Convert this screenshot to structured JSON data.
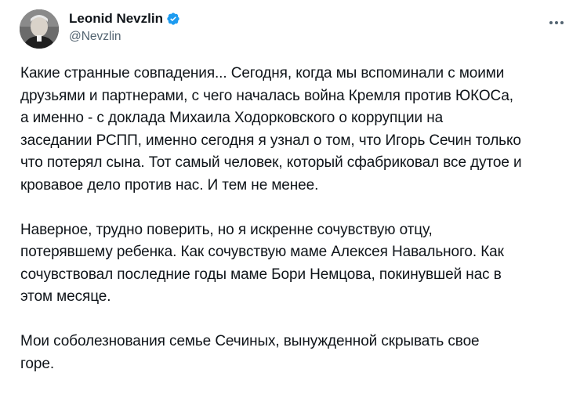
{
  "tweet": {
    "author": {
      "display_name": "Leonid Nevzlin",
      "handle": "@Nevzlin",
      "verified": true,
      "verified_color": "#1d9bf0"
    },
    "more_icon": "more-horizontal-icon",
    "paragraphs": [
      [
        "Какие странные совпадения... Сегодня, когда мы  вспоминали с моими",
        "друзьями и партнерами, с чего началась война Кремля против ЮКОСа,",
        "а  именно - с доклада Михаила Ходорковского о коррупции на",
        "заседании РСПП, именно сегодня я узнал о том, что Игорь Сечин только",
        "что потерял сына. Тот самый человек, который сфабриковал все дутое и",
        "кровавое дело против нас. И тем не менее."
      ],
      [
        "Наверное, трудно поверить, но я искренне сочувствую отцу,",
        "потерявшему ребенка. Как сочувствую маме Алексея Навального. Как",
        "сочувствовал последние годы маме Бори Немцова, покинувшей нас в",
        "этом месяце."
      ],
      [
        "Мои соболезнования семье Сечиных, вынужденной скрывать свое",
        "горе."
      ]
    ]
  }
}
